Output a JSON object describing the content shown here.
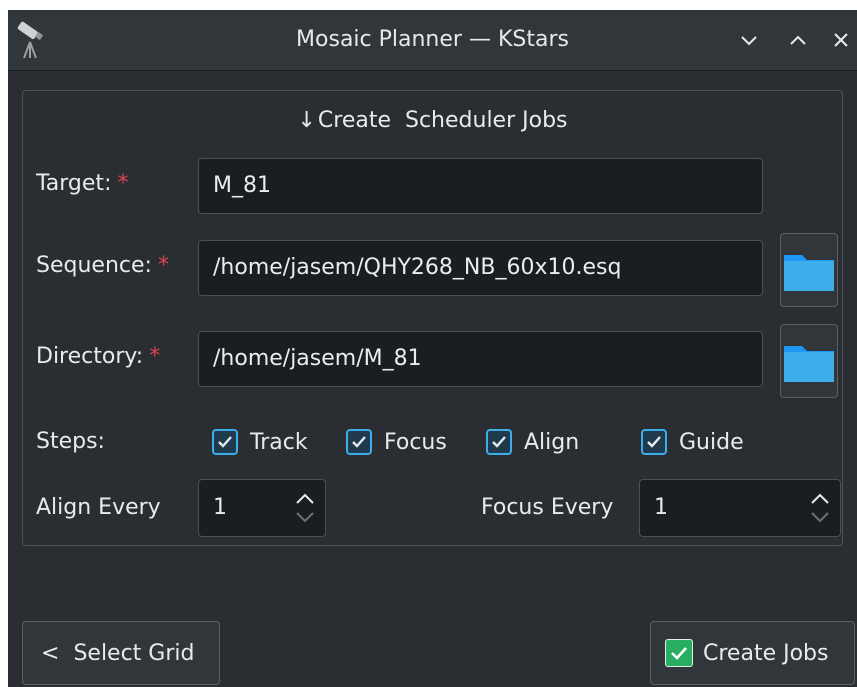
{
  "window": {
    "title": "Mosaic Planner — KStars",
    "controls": [
      "chevron-down-icon",
      "chevron-up-icon",
      "close-icon"
    ]
  },
  "section": {
    "heading_arrow": "↓",
    "heading": "Create  Scheduler Jobs"
  },
  "form": {
    "required_marker": "*",
    "target": {
      "label": "Target:",
      "value": "M_81"
    },
    "sequence": {
      "label": "Sequence:",
      "value": "/home/jasem/QHY268_NB_60x10.esq"
    },
    "directory": {
      "label": "Directory:",
      "value": "/home/jasem/M_81"
    },
    "steps": {
      "label": "Steps:",
      "items": [
        {
          "label": "Track",
          "checked": true
        },
        {
          "label": "Focus",
          "checked": true
        },
        {
          "label": "Align",
          "checked": true
        },
        {
          "label": "Guide",
          "checked": true
        }
      ]
    },
    "align_every": {
      "label": "Align Every",
      "value": "1"
    },
    "focus_every": {
      "label": "Focus Every",
      "value": "1"
    }
  },
  "footer": {
    "back_arrow": "<",
    "select_grid": "Select Grid",
    "create_jobs": "Create Jobs",
    "create_jobs_checked": true
  },
  "colors": {
    "accent": "#3daee9",
    "required": "#da4453",
    "create_check": "#27ae60",
    "folder": "#3daee9"
  }
}
